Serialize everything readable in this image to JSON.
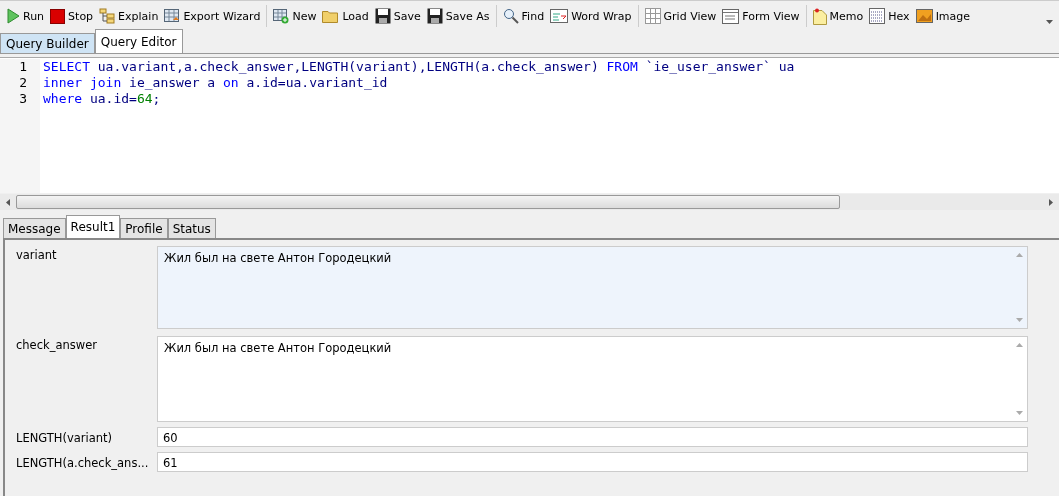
{
  "toolbar": [
    [
      "Run",
      "Stop",
      "Explain",
      "Export Wizard"
    ],
    [
      "New",
      "Load",
      "Save",
      "Save As"
    ],
    [
      "Find",
      "Word Wrap"
    ],
    [
      "Grid View",
      "Form View"
    ],
    [
      "Memo",
      "Hex",
      "Image"
    ]
  ],
  "editor_tabs": [
    {
      "label": "Query Builder",
      "selected": false
    },
    {
      "label": "Query Editor",
      "selected": true
    }
  ],
  "editor": {
    "lines": [
      {
        "number": "1",
        "tokens": [
          {
            "kind": "keyword",
            "text": "SELECT"
          },
          {
            "kind": "plain",
            "text": " ua.variant,a.check_answer,LENGTH(variant),LENGTH(a.check_answer) "
          },
          {
            "kind": "keyword",
            "text": "FROM"
          },
          {
            "kind": "plain",
            "text": " `ie_user_answer` ua"
          }
        ]
      },
      {
        "number": "2",
        "tokens": [
          {
            "kind": "keyword",
            "text": "inner join"
          },
          {
            "kind": "plain",
            "text": " ie_answer a "
          },
          {
            "kind": "keyword",
            "text": "on"
          },
          {
            "kind": "plain",
            "text": " a.id=ua.variant_id"
          }
        ]
      },
      {
        "number": "3",
        "tokens": [
          {
            "kind": "keyword",
            "text": "where"
          },
          {
            "kind": "plain",
            "text": " ua.id="
          },
          {
            "kind": "number",
            "text": "64"
          },
          {
            "kind": "plain",
            "text": ";"
          }
        ]
      }
    ]
  },
  "result_tabs": [
    {
      "label": "Message",
      "selected": false
    },
    {
      "label": "Result1",
      "selected": true
    },
    {
      "label": "Profile",
      "selected": false
    },
    {
      "label": "Status",
      "selected": false
    }
  ],
  "form": [
    {
      "label": "variant",
      "kind": "memo",
      "value": "Жил был на свете Антон Городецкий",
      "selected": true
    },
    {
      "label": "check_answer",
      "kind": "memo",
      "value": "Жил был на свете Антон Городецкий",
      "selected": false
    },
    {
      "label": "LENGTH(variant)",
      "kind": "line",
      "value": "60",
      "selected": false
    },
    {
      "label": "LENGTH(a.check_ans...",
      "kind": "line",
      "value": "61",
      "selected": false
    }
  ]
}
